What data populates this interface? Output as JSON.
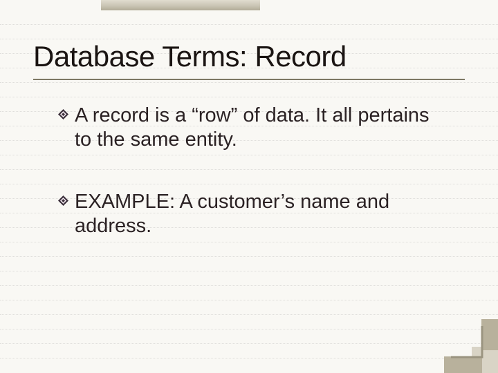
{
  "title": "Database Terms: Record",
  "bullets": [
    {
      "text": "A record is a “row” of data.  It all pertains to the same entity."
    },
    {
      "text": "EXAMPLE:  A customer’s name and address."
    }
  ]
}
